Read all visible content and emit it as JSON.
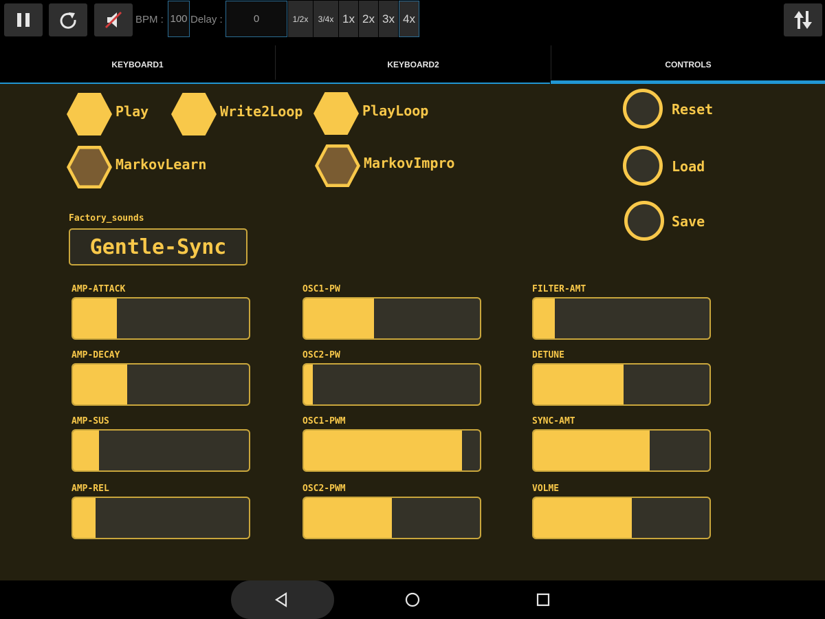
{
  "toolbar": {
    "bpm_label": "BPM :",
    "bpm_value": "100",
    "delay_label": "Delay :",
    "delay_value": "0",
    "multipliers": [
      "1/2x",
      "3/4x",
      "1x",
      "2x",
      "3x",
      "4x"
    ],
    "selected_multiplier": "4x",
    "icons": [
      "pause-icon",
      "reload-icon",
      "mute-icon",
      "swap-icon"
    ]
  },
  "tabs": [
    {
      "label": "KEYBOARD1",
      "selected": false
    },
    {
      "label": "KEYBOARD2",
      "selected": false
    },
    {
      "label": "CONTROLS",
      "selected": true
    }
  ],
  "controls": {
    "hex_buttons": [
      {
        "label": "Play",
        "state": "on"
      },
      {
        "label": "Write2Loop",
        "state": "on"
      },
      {
        "label": "PlayLoop",
        "state": "on"
      },
      {
        "label": "MarkovLearn",
        "state": "off"
      },
      {
        "label": "MarkovImpro",
        "state": "off"
      }
    ],
    "round_buttons": [
      "Reset",
      "Load",
      "Save"
    ],
    "preset_caption": "Factory_sounds",
    "preset_value": "Gentle-Sync",
    "sliders": [
      {
        "label": "AMP-ATTACK",
        "level": 0.25
      },
      {
        "label": "OSC1-PW",
        "level": 0.4
      },
      {
        "label": "FILTER-AMT",
        "level": 0.12
      },
      {
        "label": "AMP-DECAY",
        "level": 0.31
      },
      {
        "label": "OSC2-PW",
        "level": 0.05
      },
      {
        "label": "DETUNE",
        "level": 0.51
      },
      {
        "label": "AMP-SUS",
        "level": 0.15
      },
      {
        "label": "OSC1-PWM",
        "level": 0.9
      },
      {
        "label": "SYNC-AMT",
        "level": 0.66
      },
      {
        "label": "AMP-REL",
        "level": 0.13
      },
      {
        "label": "OSC2-PWM",
        "level": 0.5
      },
      {
        "label": "VOLME",
        "level": 0.56
      }
    ]
  },
  "colors": {
    "accent": "#f8c84a",
    "background": "#24200f",
    "tab_indicator": "#2196d3",
    "off_hex": "#7a5c32"
  },
  "navigation_bar": [
    "back-icon",
    "home-icon",
    "recents-icon"
  ]
}
